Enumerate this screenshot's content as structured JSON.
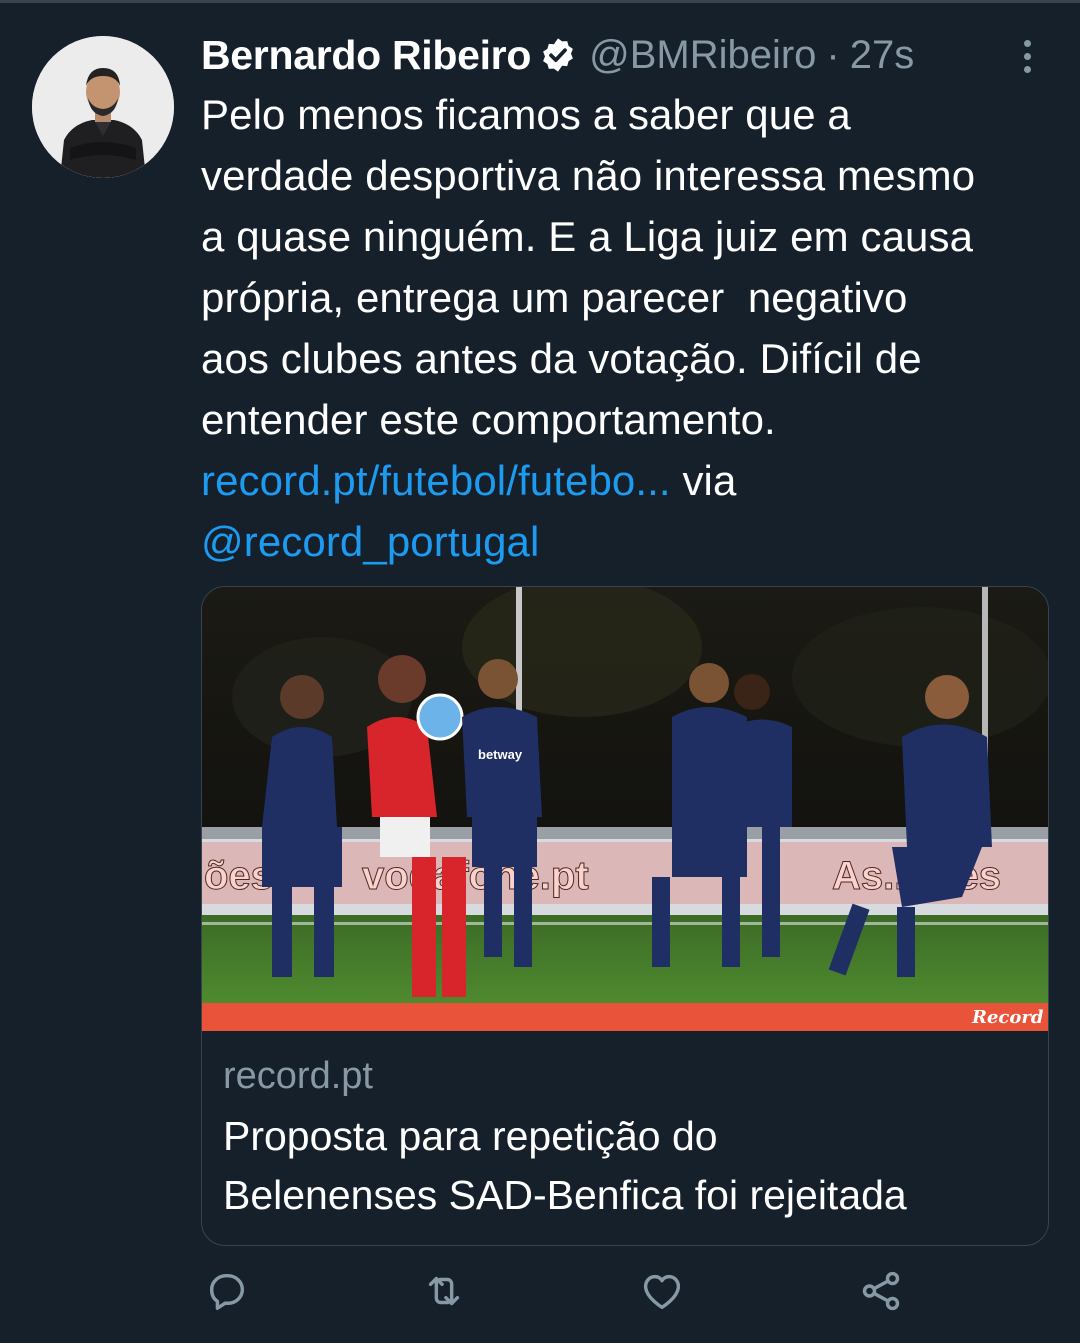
{
  "tweet": {
    "author_name": "Bernardo Ribeiro",
    "handle": "@BMRibeiro",
    "separator": "·",
    "time": "27s",
    "text_lines": [
      "Pelo menos ficamos a saber que a",
      "verdade desportiva não interessa mesmo",
      "a quase ninguém. E a Liga juiz em causa",
      "própria, entrega um parecer  negativo",
      "aos clubes antes da votação. Difícil de",
      "entender este comportamento."
    ],
    "link_text": "record.pt/futebol/futebo...",
    "via_text": " via",
    "mention": "@record_portugal",
    "verified": true
  },
  "card": {
    "domain": "record.pt",
    "title_lines": [
      "Proposta para repetição do",
      "Belenenses SAD-Benfica foi rejeitada"
    ],
    "image_watermark": "Record",
    "ad_board_left": "ões",
    "ad_board_mid": "vodafone.pt",
    "ad_board_right": "As...ores",
    "shirt_sponsor": "betway"
  },
  "actions": {
    "reply_icon": "reply-icon",
    "retweet_icon": "retweet-icon",
    "like_icon": "heart-icon",
    "share_icon": "share-icon"
  },
  "colors": {
    "background": "#15202b",
    "link": "#1d9bf0",
    "secondary_text": "#8899a6",
    "border": "#38444d"
  }
}
